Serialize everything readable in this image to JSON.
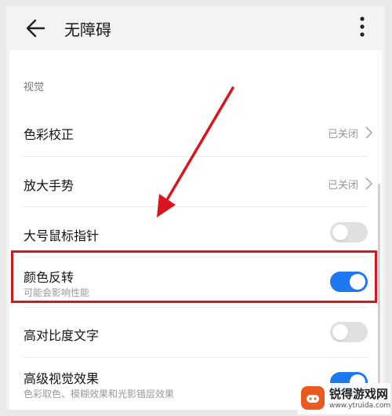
{
  "header": {
    "title": "无障碍"
  },
  "section": {
    "title": "视觉"
  },
  "rows": [
    {
      "label": "色彩校正",
      "value": "已关闭"
    },
    {
      "label": "放大手势",
      "value": "已关闭"
    },
    {
      "label": "大号鼠标指针",
      "toggle": false
    },
    {
      "label": "颜色反转",
      "sub": "可能会影响性能",
      "toggle": true
    },
    {
      "label": "高对比度文字",
      "toggle": false
    },
    {
      "label": "高级视觉效果",
      "sub": "色彩取色、模糊效果和光影错层效果",
      "toggle": true
    }
  ],
  "colors": {
    "accent": "#1e78ef",
    "highlight": "#d9161f",
    "arrow": "#d9161f"
  },
  "watermark": {
    "name": "锐得游戏网",
    "url": "www.ytruida.com"
  }
}
